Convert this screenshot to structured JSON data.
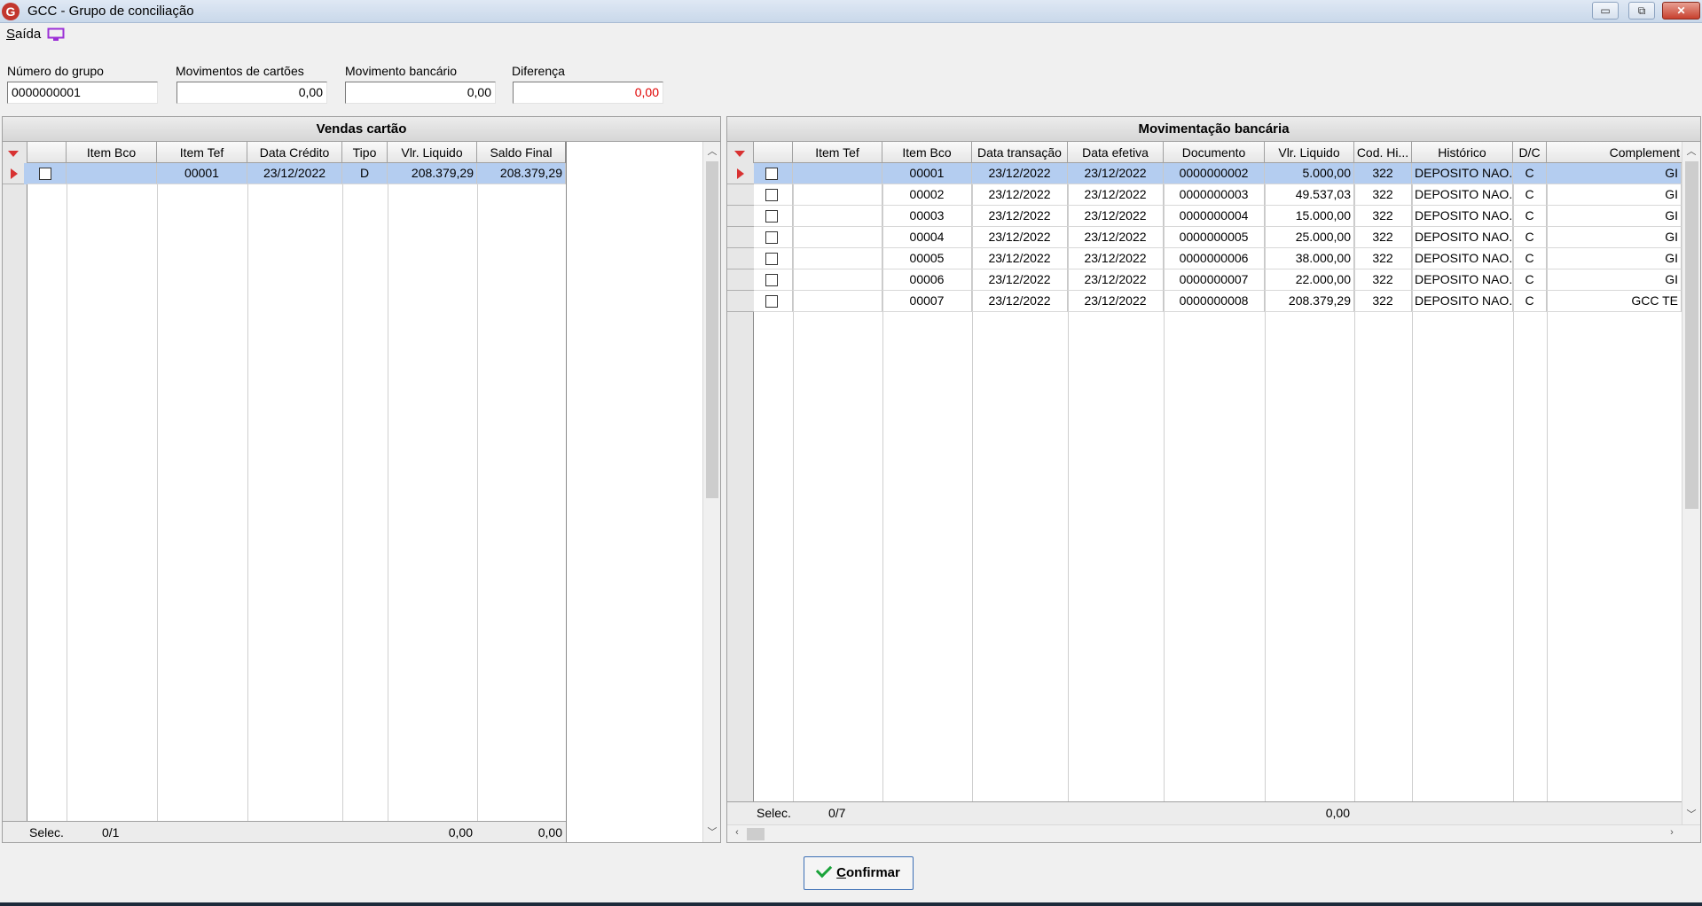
{
  "window": {
    "title": "GCC - Grupo de conciliação",
    "app_icon": "G",
    "close_glyph": "✕",
    "min_glyph": "▭",
    "max_glyph": "⧉"
  },
  "menu": {
    "saida_first": "S",
    "saida_rest": "aída"
  },
  "fields": {
    "numero_label": "Número do grupo",
    "numero_value": "0000000001",
    "mov_cartoes_label": "Movimentos de cartões",
    "mov_cartoes_value": "0,00",
    "mov_bancario_label": "Movimento bancário",
    "mov_bancario_value": "0,00",
    "diferenca_label": "Diferença",
    "diferenca_value": "0,00"
  },
  "left_panel": {
    "title": "Vendas cartão",
    "columns": [
      "Item Bco",
      "Item Tef",
      "Data Crédito",
      "Tipo",
      "Vlr. Liquido",
      "Saldo Final"
    ],
    "rows": [
      {
        "item_bco": "",
        "item_tef": "00001",
        "data_credito": "23/12/2022",
        "tipo": "D",
        "vlr_liquido": "208.379,29",
        "saldo_final": "208.379,29"
      }
    ],
    "footer": {
      "label": "Selec.",
      "count": "0/1",
      "vlr_total": "0,00",
      "saldo_total": "0,00"
    }
  },
  "right_panel": {
    "title": "Movimentação bancária",
    "columns": [
      "Item Tef",
      "Item Bco",
      "Data transação",
      "Data efetiva",
      "Documento",
      "Vlr. Liquido",
      "Cod. Hi...",
      "Histórico",
      "D/C",
      "Complement"
    ],
    "rows": [
      {
        "item_tef": "",
        "item_bco": "00001",
        "data_transacao": "23/12/2022",
        "data_efetiva": "23/12/2022",
        "documento": "0000000002",
        "vlr_liquido": "5.000,00",
        "cod_hist": "322",
        "historico": "DEPOSITO NAO...",
        "dc": "C",
        "complemento": "GI"
      },
      {
        "item_tef": "",
        "item_bco": "00002",
        "data_transacao": "23/12/2022",
        "data_efetiva": "23/12/2022",
        "documento": "0000000003",
        "vlr_liquido": "49.537,03",
        "cod_hist": "322",
        "historico": "DEPOSITO NAO...",
        "dc": "C",
        "complemento": "GI"
      },
      {
        "item_tef": "",
        "item_bco": "00003",
        "data_transacao": "23/12/2022",
        "data_efetiva": "23/12/2022",
        "documento": "0000000004",
        "vlr_liquido": "15.000,00",
        "cod_hist": "322",
        "historico": "DEPOSITO NAO...",
        "dc": "C",
        "complemento": "GI"
      },
      {
        "item_tef": "",
        "item_bco": "00004",
        "data_transacao": "23/12/2022",
        "data_efetiva": "23/12/2022",
        "documento": "0000000005",
        "vlr_liquido": "25.000,00",
        "cod_hist": "322",
        "historico": "DEPOSITO NAO...",
        "dc": "C",
        "complemento": "GI"
      },
      {
        "item_tef": "",
        "item_bco": "00005",
        "data_transacao": "23/12/2022",
        "data_efetiva": "23/12/2022",
        "documento": "0000000006",
        "vlr_liquido": "38.000,00",
        "cod_hist": "322",
        "historico": "DEPOSITO NAO...",
        "dc": "C",
        "complemento": "GI"
      },
      {
        "item_tef": "",
        "item_bco": "00006",
        "data_transacao": "23/12/2022",
        "data_efetiva": "23/12/2022",
        "documento": "0000000007",
        "vlr_liquido": "22.000,00",
        "cod_hist": "322",
        "historico": "DEPOSITO NAO...",
        "dc": "C",
        "complemento": "GI"
      },
      {
        "item_tef": "",
        "item_bco": "00007",
        "data_transacao": "23/12/2022",
        "data_efetiva": "23/12/2022",
        "documento": "0000000008",
        "vlr_liquido": "208.379,29",
        "cod_hist": "322",
        "historico": "DEPOSITO NAO...",
        "dc": "C",
        "complemento": "GCC TE"
      }
    ],
    "footer": {
      "label": "Selec.",
      "count": "0/7",
      "vlr_total": "0,00"
    }
  },
  "confirm_button": {
    "first": "C",
    "rest": "onfirmar"
  },
  "colors": {
    "accent": "#3c6fb5",
    "selected_row": "#b4cdf0",
    "indicator_red": "#d83232",
    "diff_red": "#e00000"
  }
}
